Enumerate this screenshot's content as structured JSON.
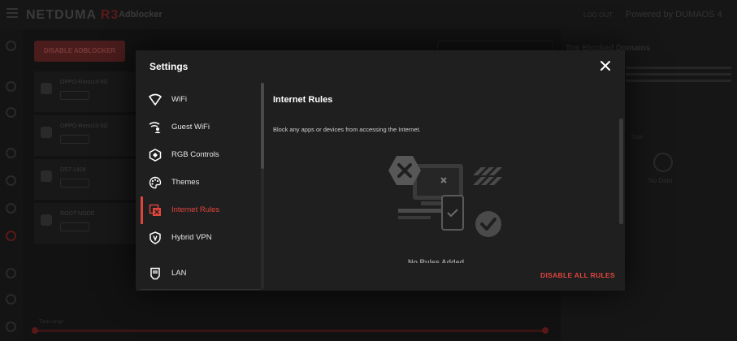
{
  "background": {
    "logo_main": "NETDUMA",
    "logo_accent": "R3",
    "app_name": "Adblocker",
    "header_right": "Powered by DUMAOS 4",
    "logout_label": "LOG OUT",
    "disable_button": "DISABLE ADBLOCKER",
    "devices": [
      {
        "name": "OPPO-Reno13-5G",
        "status": "Disabled"
      },
      {
        "name": "OPPO-Reno13-5G",
        "status": "Disabled"
      },
      {
        "name": "DST-1408",
        "status": "Disabled"
      },
      {
        "name": "ROOT-NODE",
        "status": "Disabled"
      }
    ],
    "right_panel": {
      "title": "Top Blocked Domains",
      "total_label": "Total",
      "no_data": "No Data"
    },
    "slider_label": "Time range"
  },
  "modal": {
    "title": "Settings",
    "nav": [
      {
        "label": "WiFi",
        "icon": "wifi-icon"
      },
      {
        "label": "Guest WiFi",
        "icon": "guest-wifi-icon"
      },
      {
        "label": "RGB Controls",
        "icon": "rgb-controls-icon"
      },
      {
        "label": "Themes",
        "icon": "palette-icon"
      },
      {
        "label": "Internet Rules",
        "icon": "internet-rules-icon",
        "active": true
      },
      {
        "label": "Hybrid VPN",
        "icon": "shield-icon"
      },
      {
        "label": "LAN",
        "icon": "lan-icon"
      }
    ],
    "content": {
      "title": "Internet Rules",
      "description": "Block any apps or devices from accessing the Internet.",
      "empty_state": "No Rules Added",
      "disable_all_label": "DISABLE ALL RULES"
    }
  },
  "colors": {
    "accent": "#e0453d",
    "modal_bg": "#1f1f1f",
    "page_bg": "#121212"
  }
}
